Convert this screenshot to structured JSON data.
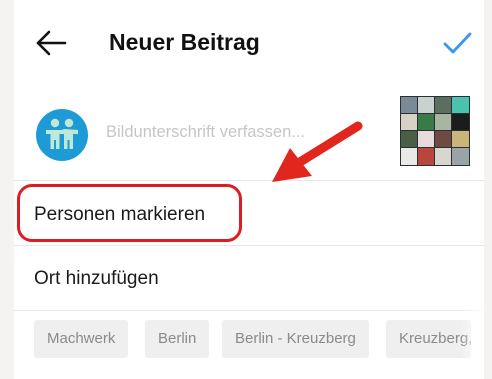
{
  "header": {
    "title": "Neuer Beitrag",
    "back_icon": "arrow-left-icon",
    "confirm_icon": "checkmark-icon"
  },
  "composer": {
    "avatar_icon": "family-avatar-icon",
    "caption_placeholder": "Bildunterschrift verfassen..."
  },
  "options": {
    "tag_people": "Personen markieren",
    "add_location": "Ort hinzufügen"
  },
  "location_suggestions": [
    "Machwerk",
    "Berlin",
    "Berlin - Kreuzberg",
    "Kreuzberg, B"
  ],
  "colors": {
    "accent": "#3897f0",
    "highlight": "#dc1e24",
    "avatar_bg": "#1e9bd7",
    "avatar_figure": "#bfe8d6"
  }
}
